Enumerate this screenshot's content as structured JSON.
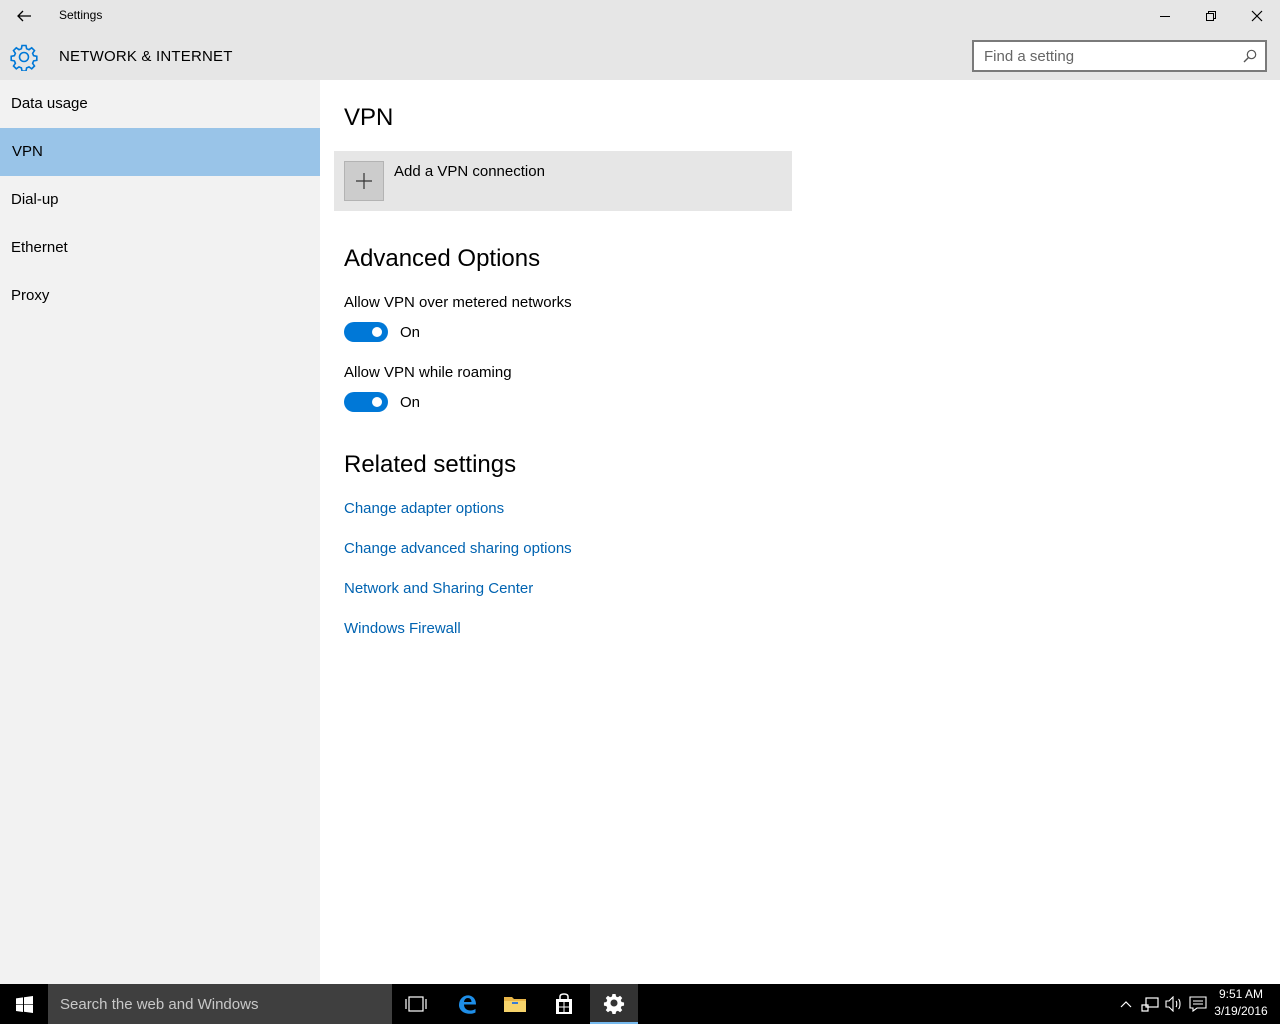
{
  "window": {
    "title": "Settings"
  },
  "header": {
    "section_title": "NETWORK & INTERNET",
    "search_placeholder": "Find a setting"
  },
  "sidebar": {
    "items": [
      {
        "label": "Data usage"
      },
      {
        "label": "VPN",
        "selected": true
      },
      {
        "label": "Dial-up"
      },
      {
        "label": "Ethernet"
      },
      {
        "label": "Proxy"
      }
    ]
  },
  "main": {
    "vpn_heading": "VPN",
    "add_vpn_label": "Add a VPN connection",
    "advanced_heading": "Advanced Options",
    "options": [
      {
        "label": "Allow VPN over metered networks",
        "state": "On"
      },
      {
        "label": "Allow VPN while roaming",
        "state": "On"
      }
    ],
    "related_heading": "Related settings",
    "related_links": [
      {
        "label": "Change adapter options"
      },
      {
        "label": "Change advanced sharing options"
      },
      {
        "label": "Network and Sharing Center"
      },
      {
        "label": "Windows Firewall"
      }
    ]
  },
  "taskbar": {
    "search_placeholder": "Search the web and Windows",
    "clock_time": "9:51 AM",
    "clock_date": "3/19/2016",
    "pinned_icons": [
      "task-view-icon",
      "edge-icon",
      "file-explorer-icon",
      "store-icon",
      "settings-icon"
    ],
    "tray_icons": [
      "chevron-up-icon",
      "network-icon",
      "volume-icon",
      "action-center-icon"
    ]
  },
  "colors": {
    "accent": "#0078d7",
    "selection": "#99c4e8",
    "link": "#0063b1",
    "chrome": "#e6e6e6",
    "sidebar": "#f2f2f2"
  }
}
